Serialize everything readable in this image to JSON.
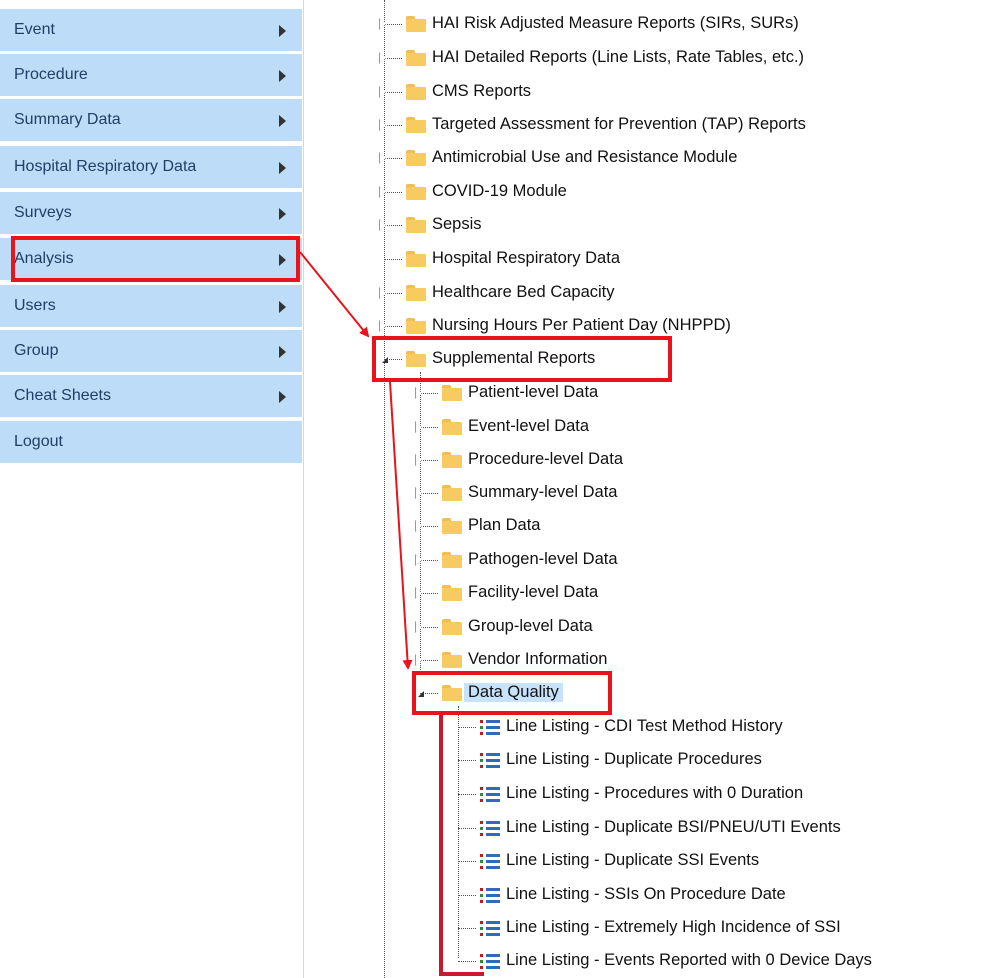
{
  "menu": {
    "items": [
      {
        "label": "Event"
      },
      {
        "label": "Procedure"
      },
      {
        "label": "Summary Data"
      },
      {
        "label": "Hospital Respiratory Data"
      },
      {
        "label": "Surveys"
      },
      {
        "label": "Analysis"
      },
      {
        "label": "Users"
      },
      {
        "label": "Group"
      },
      {
        "label": "Cheat Sheets"
      },
      {
        "label": "Logout"
      }
    ]
  },
  "tree": {
    "top_folders": [
      {
        "label": "HAI Risk Adjusted Measure Reports (SIRs, SURs)"
      },
      {
        "label": "HAI Detailed Reports (Line Lists, Rate Tables, etc.)"
      },
      {
        "label": "CMS Reports"
      },
      {
        "label": "Targeted Assessment for Prevention (TAP) Reports"
      },
      {
        "label": "Antimicrobial Use and Resistance Module"
      },
      {
        "label": "COVID-19 Module"
      },
      {
        "label": "Sepsis"
      },
      {
        "label": "Hospital Respiratory Data"
      },
      {
        "label": "Healthcare Bed Capacity"
      },
      {
        "label": "Nursing Hours Per Patient Day (NHPPD)"
      },
      {
        "label": "Supplemental Reports"
      }
    ],
    "supplemental_children": [
      {
        "label": "Patient-level Data"
      },
      {
        "label": "Event-level Data"
      },
      {
        "label": "Procedure-level Data"
      },
      {
        "label": "Summary-level Data"
      },
      {
        "label": "Plan Data"
      },
      {
        "label": "Pathogen-level Data"
      },
      {
        "label": "Facility-level Data"
      },
      {
        "label": "Group-level Data"
      },
      {
        "label": "Vendor Information"
      },
      {
        "label": "Data Quality"
      }
    ],
    "data_quality_reports": [
      {
        "label": "Line Listing - CDI Test Method History"
      },
      {
        "label": "Line Listing - Duplicate Procedures"
      },
      {
        "label": "Line Listing - Procedures with 0 Duration"
      },
      {
        "label": "Line Listing - Duplicate BSI/PNEU/UTI Events"
      },
      {
        "label": "Line Listing - Duplicate SSI Events"
      },
      {
        "label": "Line Listing - SSIs On Procedure Date"
      },
      {
        "label": "Line Listing - Extremely High Incidence of SSI"
      },
      {
        "label": "Line Listing - Events Reported with 0 Device Days"
      }
    ]
  },
  "colors": {
    "menu_bg": "#bcdcf7",
    "highlight": "#e8131b",
    "selected_bg": "#c7e3fb"
  }
}
